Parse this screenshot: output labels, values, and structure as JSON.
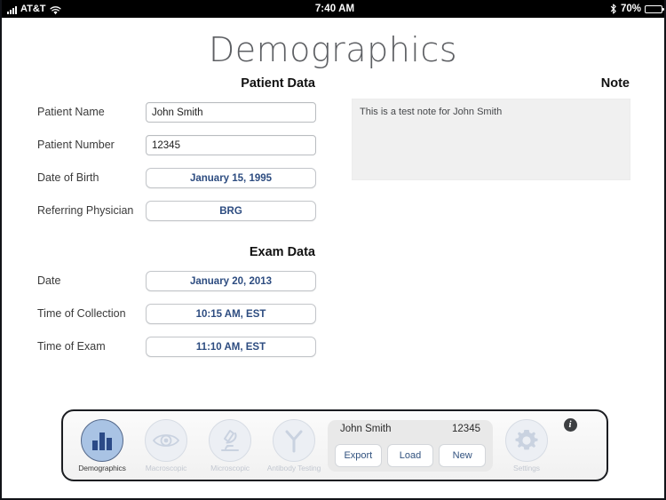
{
  "status_bar": {
    "signal_icon": "signal-bars-icon",
    "carrier": "AT&T",
    "wifi_icon": "wifi-icon",
    "time": "7:40 AM",
    "bluetooth_icon": "bluetooth-icon",
    "battery_percent": "70%",
    "battery_icon": "battery-icon",
    "battery_level": 70
  },
  "page": {
    "title": "Demographics"
  },
  "patient_data": {
    "section_title": "Patient Data",
    "rows": [
      {
        "label": "Patient Name",
        "value": "John Smith",
        "kind": "text"
      },
      {
        "label": "Patient Number",
        "value": "12345",
        "kind": "text"
      },
      {
        "label": "Date of Birth",
        "value": "January 15, 1995",
        "kind": "button"
      },
      {
        "label": "Referring Physician",
        "value": "BRG",
        "kind": "button"
      }
    ]
  },
  "exam_data": {
    "section_title": "Exam Data",
    "rows": [
      {
        "label": "Date",
        "value": "January 20, 2013",
        "kind": "button"
      },
      {
        "label": "Time of Collection",
        "value": "10:15 AM, EST",
        "kind": "button"
      },
      {
        "label": "Time of Exam",
        "value": "11:10 AM, EST",
        "kind": "button"
      }
    ]
  },
  "note": {
    "section_title": "Note",
    "text": "This is a test note for John Smith"
  },
  "toolbar": {
    "tabs": [
      {
        "label": "Demographics",
        "icon": "bar-chart-icon",
        "active": true
      },
      {
        "label": "Macroscopic",
        "icon": "eye-icon",
        "active": false
      },
      {
        "label": "Microscopic",
        "icon": "microscope-icon",
        "active": false
      },
      {
        "label": "Antibody Testing",
        "icon": "antibody-icon",
        "active": false
      }
    ],
    "patient_panel": {
      "name": "John Smith",
      "number": "12345",
      "buttons": [
        {
          "label": "Export"
        },
        {
          "label": "Load"
        },
        {
          "label": "New"
        }
      ]
    },
    "settings": {
      "label": "Settings",
      "icon": "gear-icon"
    },
    "info": {
      "label": "i",
      "icon": "info-icon"
    }
  },
  "colors": {
    "accent_blue": "#2d4c80",
    "active_circle": "#a9c3e4",
    "inactive_circle": "#eceff4",
    "note_background": "#f0f0f0",
    "title_gray": "#5d5f63"
  }
}
